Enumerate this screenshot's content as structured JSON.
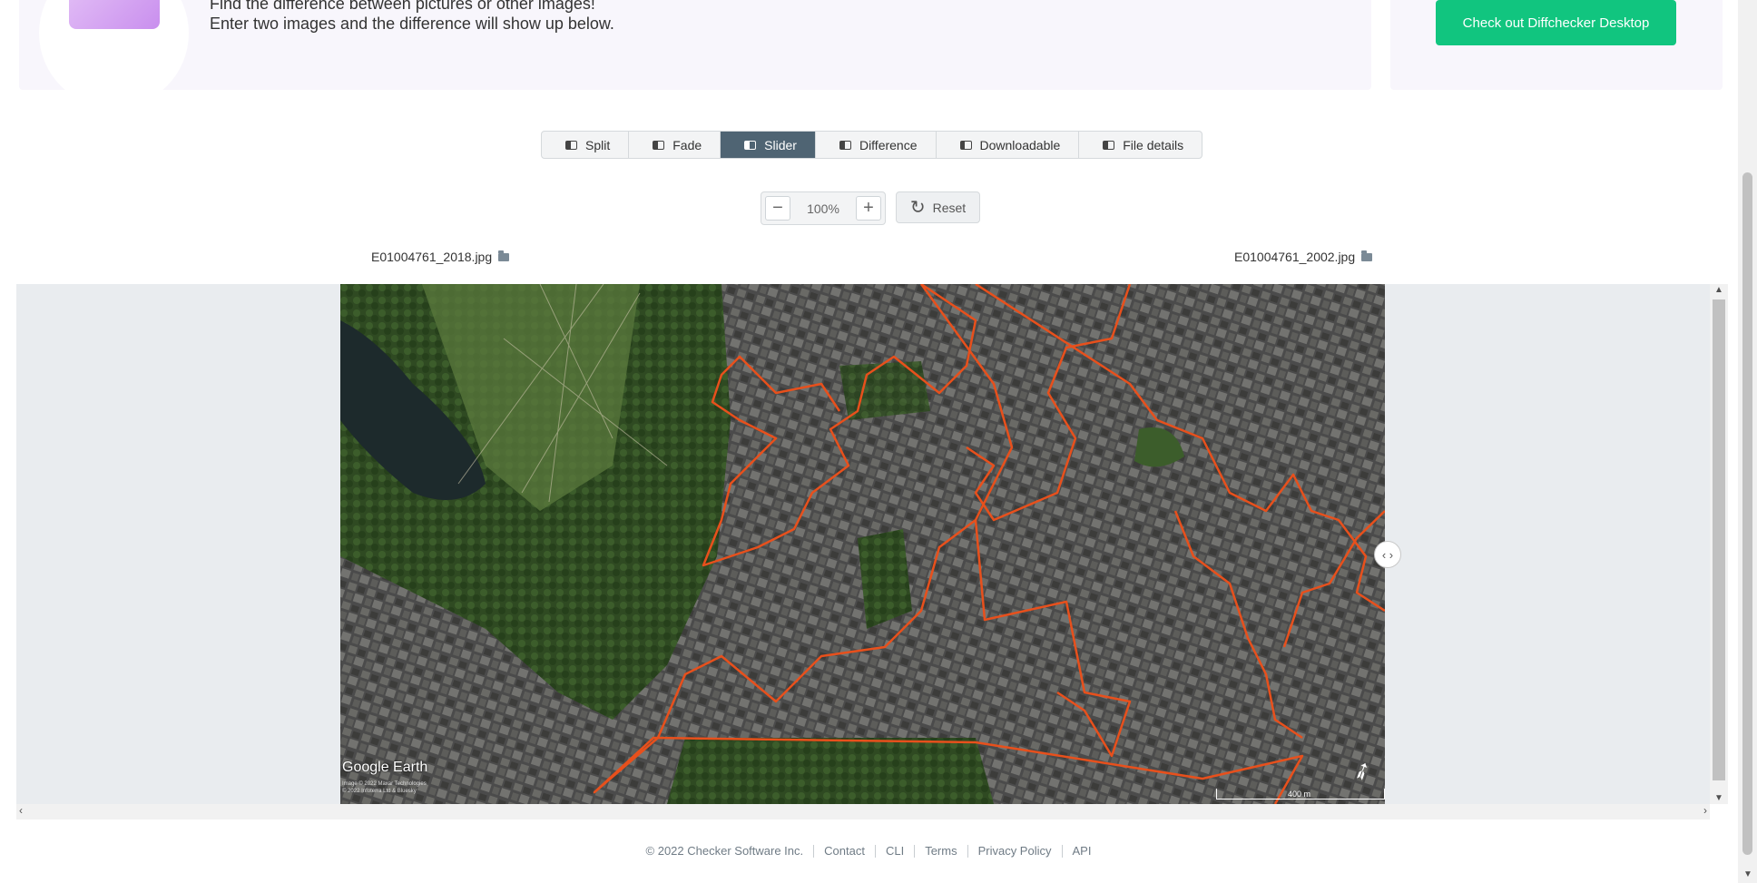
{
  "hero": {
    "line1": "Find the difference between pictures or other images!",
    "line2": "Enter two images and the difference will show up below.",
    "cta_label": "Check out Diffchecker Desktop"
  },
  "tabs": [
    {
      "label": "Split",
      "icon": "split-icon"
    },
    {
      "label": "Fade",
      "icon": "fade-icon"
    },
    {
      "label": "Slider",
      "icon": "slider-icon",
      "active": true
    },
    {
      "label": "Difference",
      "icon": "difference-icon"
    },
    {
      "label": "Downloadable",
      "icon": "download-icon"
    },
    {
      "label": "File details",
      "icon": "file-details-icon"
    }
  ],
  "zoom": {
    "minus": "−",
    "value": "100%",
    "plus": "+",
    "reset_label": "Reset"
  },
  "files": {
    "left": "E01004761_2018.jpg",
    "right": "E01004761_2002.jpg"
  },
  "map": {
    "logo": "Google Earth",
    "copyright_1": "Image © 2022 Maxar Technologies",
    "copyright_2": "© 2022 Infoterra Ltd & Bluesky",
    "scale": "400 m",
    "boundary_color": "#e8501c"
  },
  "footer": {
    "copyright": "© 2022 Checker Software Inc.",
    "links": [
      "Contact",
      "CLI",
      "Terms",
      "Privacy Policy",
      "API"
    ]
  },
  "colors": {
    "accent": "#11c57f",
    "active_tab": "#4f6473"
  }
}
